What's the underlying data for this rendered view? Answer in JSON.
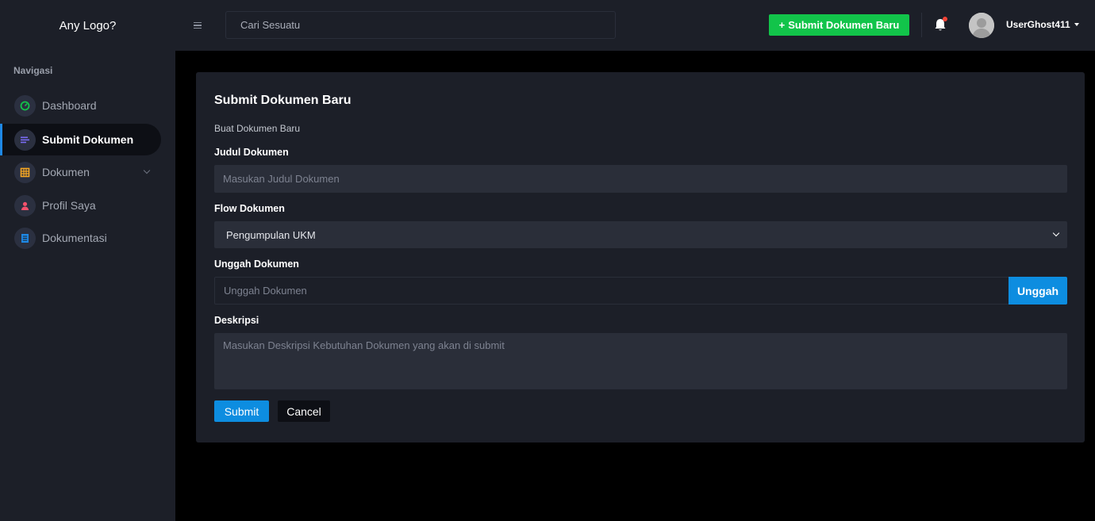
{
  "header": {
    "logo_text": "Any Logo?",
    "search_placeholder": "Cari Sesuatu",
    "new_button_icon": "+",
    "new_button_label": "Submit Dokumen Baru",
    "username": "UserGhost411",
    "bell_icon": "bell-icon",
    "notification_dot_color": "#f44336"
  },
  "sidebar": {
    "heading": "Navigasi",
    "items": [
      {
        "label": "Dashboard",
        "icon": "gauge-icon",
        "icon_color": "#12c44a",
        "active": false
      },
      {
        "label": "Submit Dokumen",
        "icon": "list-icon",
        "icon_color": "#7b6cf6",
        "active": true
      },
      {
        "label": "Dokumen",
        "icon": "grid-icon",
        "icon_color": "#f5a623",
        "active": false,
        "has_submenu": true
      },
      {
        "label": "Profil Saya",
        "icon": "user-icon",
        "icon_color": "#f4516c",
        "active": false
      },
      {
        "label": "Dokumentasi",
        "icon": "document-icon",
        "icon_color": "#1e88e5",
        "active": false
      }
    ]
  },
  "form": {
    "title": "Submit Dokumen Baru",
    "subtitle": "Buat Dokumen Baru",
    "judul_label": "Judul Dokumen",
    "judul_placeholder": "Masukan Judul Dokumen",
    "flow_label": "Flow Dokumen",
    "flow_selected": "Pengumpulan UKM",
    "unggah_label": "Unggah Dokumen",
    "unggah_placeholder": "Unggah Dokumen",
    "unggah_button": "Unggah",
    "deskripsi_label": "Deskripsi",
    "deskripsi_placeholder": "Masukan Deskripsi Kebutuhan Dokumen yang akan di submit",
    "submit_button": "Submit",
    "cancel_button": "Cancel"
  },
  "colors": {
    "accent_blue": "#0d8de0",
    "accent_green": "#12c44a",
    "panel_bg": "#1c1f28",
    "page_bg": "#000000"
  }
}
